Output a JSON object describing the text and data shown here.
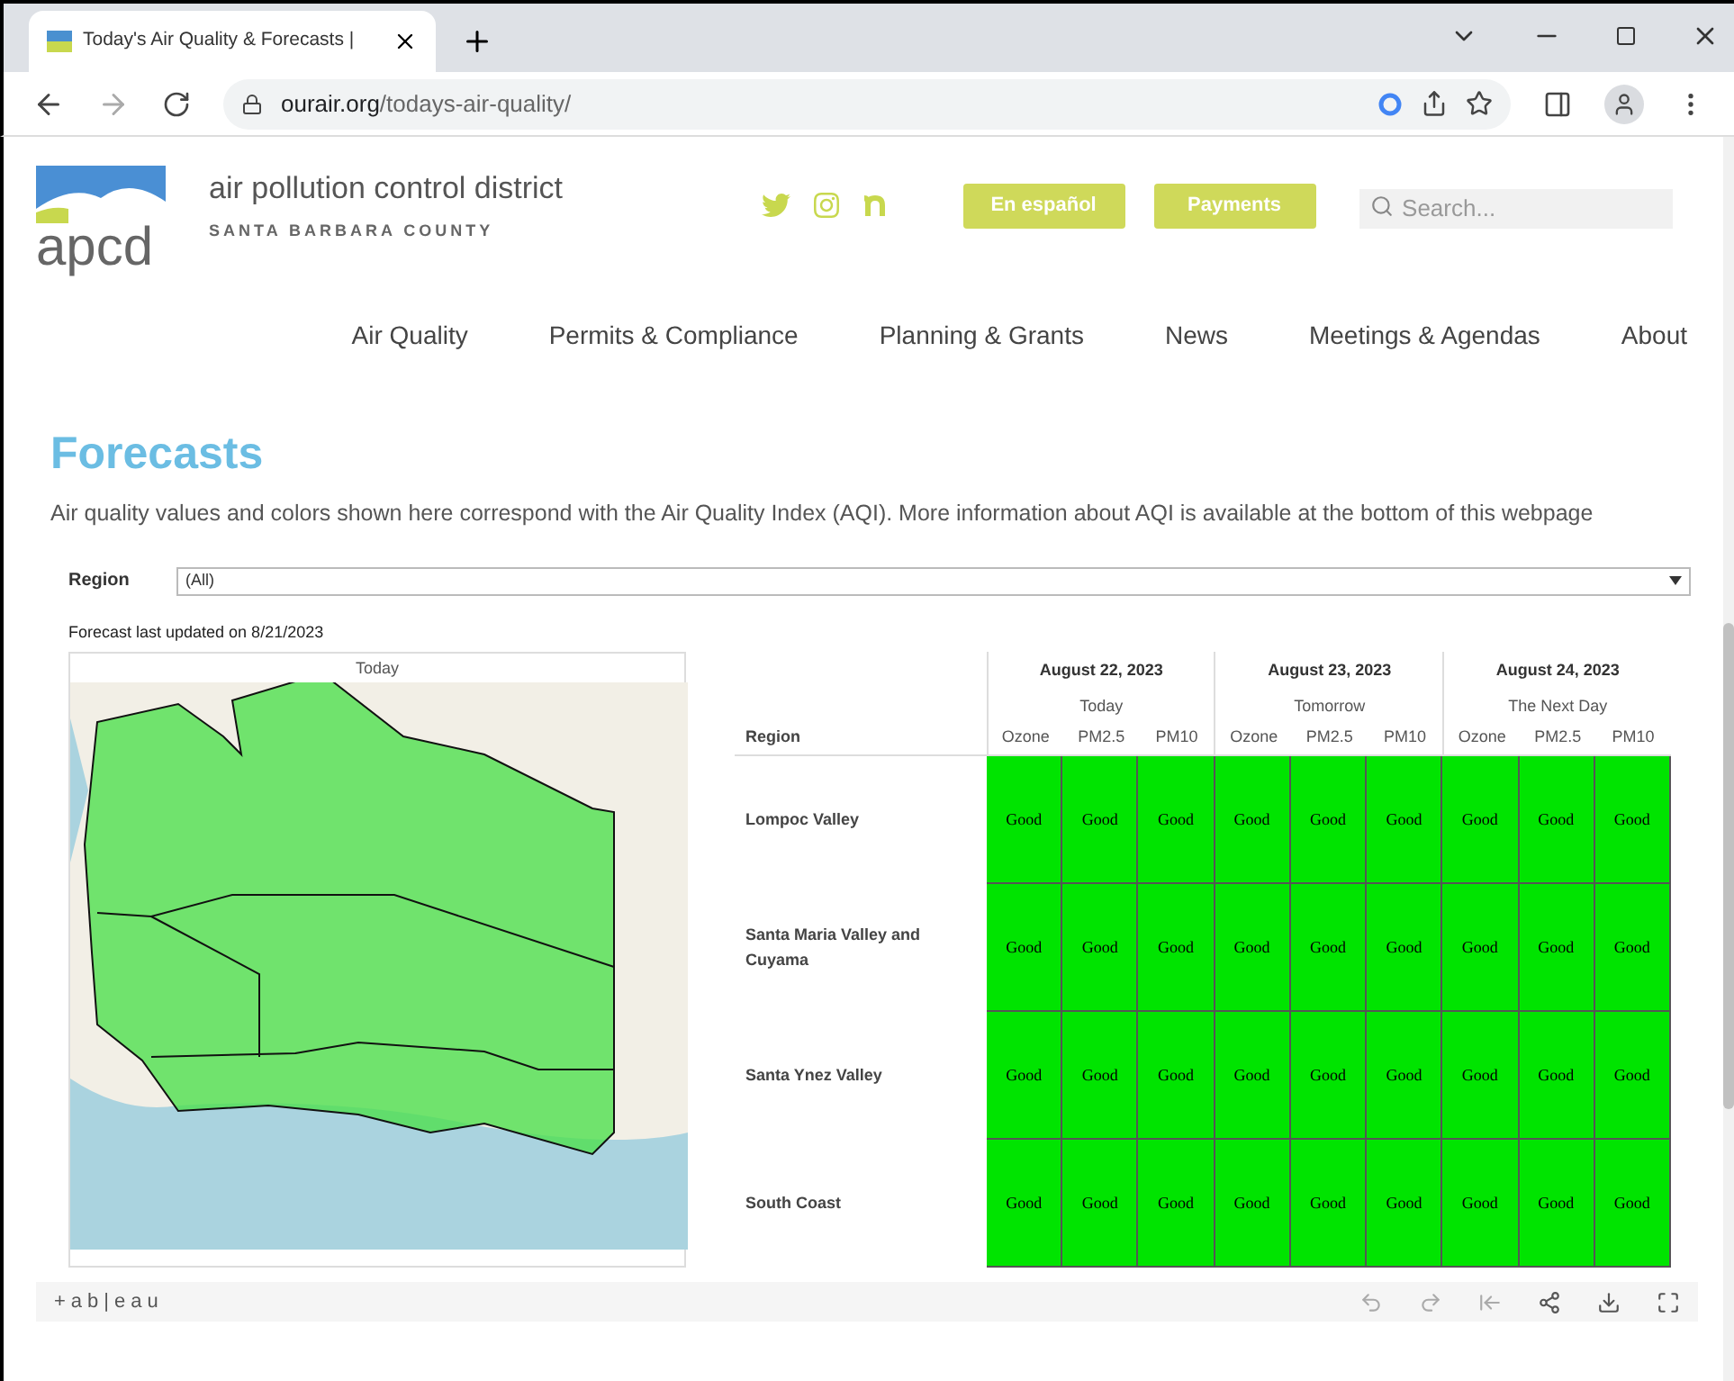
{
  "browser": {
    "tab_title": "Today's Air Quality & Forecasts | ",
    "url_domain": "ourair.org",
    "url_path": "/todays-air-quality/"
  },
  "header": {
    "logo_text": "apcd",
    "org_name": "air pollution control district",
    "org_sub": "SANTA BARBARA COUNTY",
    "buttons": [
      "En español",
      "Payments"
    ],
    "search": {
      "placeholder": "Search..."
    }
  },
  "nav": [
    "Air Quality",
    "Permits & Compliance",
    "Planning & Grants",
    "News",
    "Meetings & Agendas",
    "About"
  ],
  "heading": "Forecasts",
  "intro": "Air quality values and colors shown here correspond with the Air Quality Index (AQI). More information about AQI is available at the bottom of this webpage",
  "dashboard": {
    "region_label": "Region",
    "region_value": "(All)",
    "updated": "Forecast last updated on 8/21/2023",
    "map_title": "Today",
    "table": {
      "region_header": "Region",
      "days": [
        {
          "date": "August 22, 2023",
          "label": "Today"
        },
        {
          "date": "August 23, 2023",
          "label": "Tomorrow"
        },
        {
          "date": "August 24, 2023",
          "label": "The Next Day"
        }
      ],
      "pollutants": [
        "Ozone",
        "PM2.5",
        "PM10",
        "Ozone",
        "PM2.5",
        "PM10",
        "Ozone",
        "PM2.5",
        "PM10"
      ],
      "rows": [
        {
          "region": "Lompoc Valley",
          "cells": [
            {
              "text": "Good",
              "color": "#00e400"
            },
            {
              "text": "Good",
              "color": "#00e400"
            },
            {
              "text": "Good",
              "color": "#00e400"
            },
            {
              "text": "Good",
              "color": "#00e400"
            },
            {
              "text": "Good",
              "color": "#00e400"
            },
            {
              "text": "Good",
              "color": "#00e400"
            },
            {
              "text": "Good",
              "color": "#00e400"
            },
            {
              "text": "Good",
              "color": "#00e400"
            },
            {
              "text": "Good",
              "color": "#00e400"
            }
          ]
        },
        {
          "region": "Santa Maria Valley and Cuyama",
          "cells": [
            {
              "text": "Good",
              "color": "#00e400"
            },
            {
              "text": "Good",
              "color": "#00e400"
            },
            {
              "text": "Good",
              "color": "#00e400"
            },
            {
              "text": "Good",
              "color": "#00e400"
            },
            {
              "text": "Good",
              "color": "#00e400"
            },
            {
              "text": "Good",
              "color": "#00e400"
            },
            {
              "text": "Good",
              "color": "#00e400"
            },
            {
              "text": "Good",
              "color": "#00e400"
            },
            {
              "text": "Good",
              "color": "#00e400"
            }
          ]
        },
        {
          "region": "Santa Ynez Valley",
          "cells": [
            {
              "text": "Good",
              "color": "#00e400"
            },
            {
              "text": "Good",
              "color": "#00e400"
            },
            {
              "text": "Good",
              "color": "#00e400"
            },
            {
              "text": "Good",
              "color": "#00e400"
            },
            {
              "text": "Good",
              "color": "#00e400"
            },
            {
              "text": "Good",
              "color": "#00e400"
            },
            {
              "text": "Good",
              "color": "#00e400"
            },
            {
              "text": "Good",
              "color": "#00e400"
            },
            {
              "text": "Good",
              "color": "#00e400"
            }
          ]
        },
        {
          "region": "South Coast",
          "cells": [
            {
              "text": "Good",
              "color": "#00e400"
            },
            {
              "text": "Good",
              "color": "#00e400"
            },
            {
              "text": "Good",
              "color": "#00e400"
            },
            {
              "text": "Good",
              "color": "#00e400"
            },
            {
              "text": "Good",
              "color": "#00e400"
            },
            {
              "text": "Good",
              "color": "#00e400"
            },
            {
              "text": "Good",
              "color": "#00e400"
            },
            {
              "text": "Good",
              "color": "#00e400"
            },
            {
              "text": "Good",
              "color": "#00e400"
            }
          ]
        }
      ]
    },
    "footer_logo": "+ab|eau"
  }
}
